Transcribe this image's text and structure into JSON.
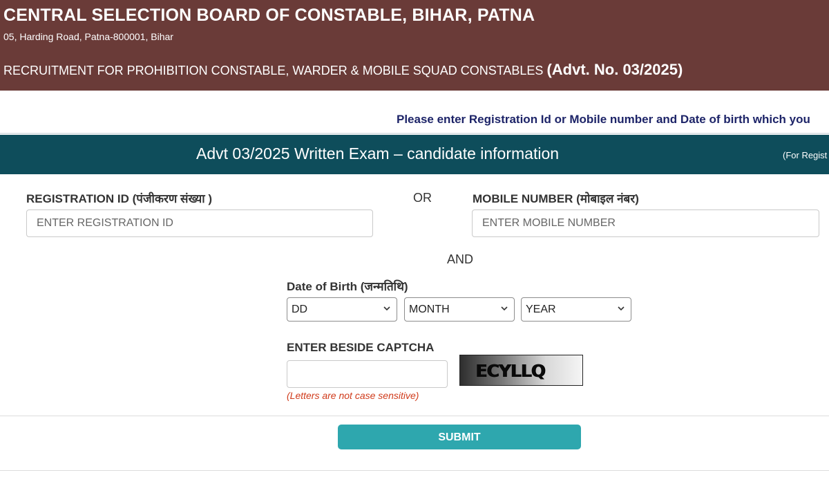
{
  "header": {
    "title": "CENTRAL SELECTION BOARD OF CONSTABLE, BIHAR, PATNA",
    "address": "05, Harding Road, Patna-800001, Bihar",
    "recruitment": "RECRUITMENT FOR PROHIBITION CONSTABLE, WARDER & MOBILE SQUAD CONSTABLES",
    "advt": "(Advt. No. 03/2025)"
  },
  "instruction": "Please enter Registration Id or Mobile number and Date of birth which you",
  "banner": {
    "title": "Advt 03/2025 Written Exam – candidate information",
    "note": "(For Regist"
  },
  "form": {
    "registration_label": "REGISTRATION ID (पंजीकरण संख्या )",
    "registration_placeholder": "ENTER REGISTRATION ID",
    "registration_value": "",
    "or_text": "OR",
    "mobile_label": "MOBILE NUMBER (मोबाइल नंबर)",
    "mobile_placeholder": "ENTER MOBILE NUMBER",
    "mobile_value": "",
    "and_text": "AND",
    "dob_label": "Date of Birth (जन्मतिथि)",
    "dob_day": "DD",
    "dob_month": "MONTH",
    "dob_year": "YEAR",
    "captcha_label": "ENTER BESIDE CAPTCHA",
    "captcha_value": "",
    "captcha_text": "ECYLLQ",
    "captcha_hint": "(Letters are not case sensitive)",
    "submit_label": "SUBMIT"
  },
  "colors": {
    "header_bg": "#6a3b38",
    "banner_bg": "#0e4d5b",
    "instruction_text": "#1d2468",
    "submit_bg": "#2ea7ae",
    "hint_text": "#d03a1a"
  },
  "icons": {
    "dropdown": "chevron-down-icon"
  }
}
